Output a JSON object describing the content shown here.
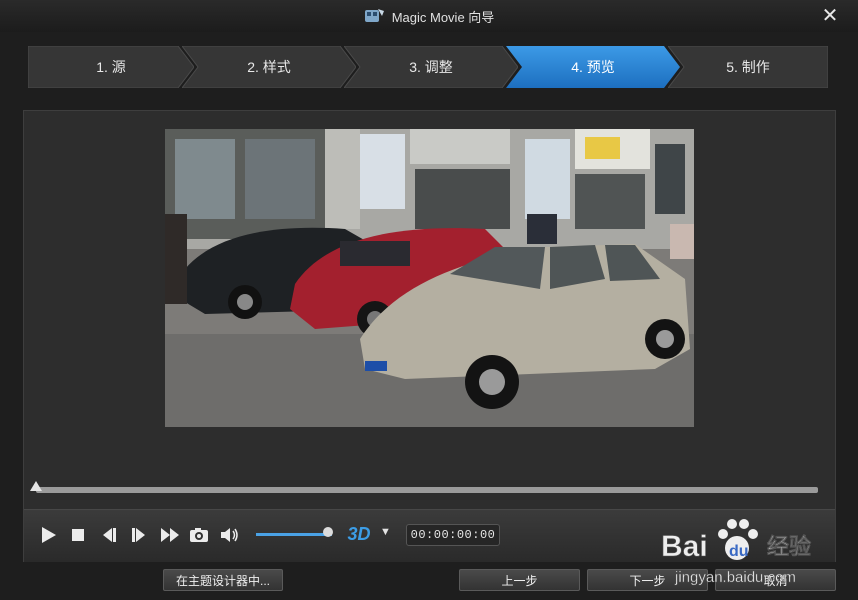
{
  "window": {
    "title": "Magic Movie 向导"
  },
  "steps": [
    {
      "label": "1. 源",
      "active": false
    },
    {
      "label": "2. 样式",
      "active": false
    },
    {
      "label": "3. 调整",
      "active": false
    },
    {
      "label": "4. 预览",
      "active": true
    },
    {
      "label": "5. 制作",
      "active": false
    }
  ],
  "player": {
    "progress": 0.0,
    "volume": 0.95,
    "timecode": "00:00:00:00",
    "badge_3d": "3D",
    "icons": [
      "play-icon",
      "stop-icon",
      "prev-frame-icon",
      "next-frame-icon",
      "fast-forward-icon",
      "camera-icon",
      "volume-icon"
    ]
  },
  "buttons": {
    "theme_designer": "在主题设计器中...",
    "back": "上一步",
    "next": "下一步",
    "cancel": "取消"
  },
  "watermark": {
    "text": "Bai 经验",
    "url": "jingyan.baidu.com"
  },
  "colors": {
    "accent": "#2e86d6",
    "step_bg": "#3a3a3a"
  }
}
